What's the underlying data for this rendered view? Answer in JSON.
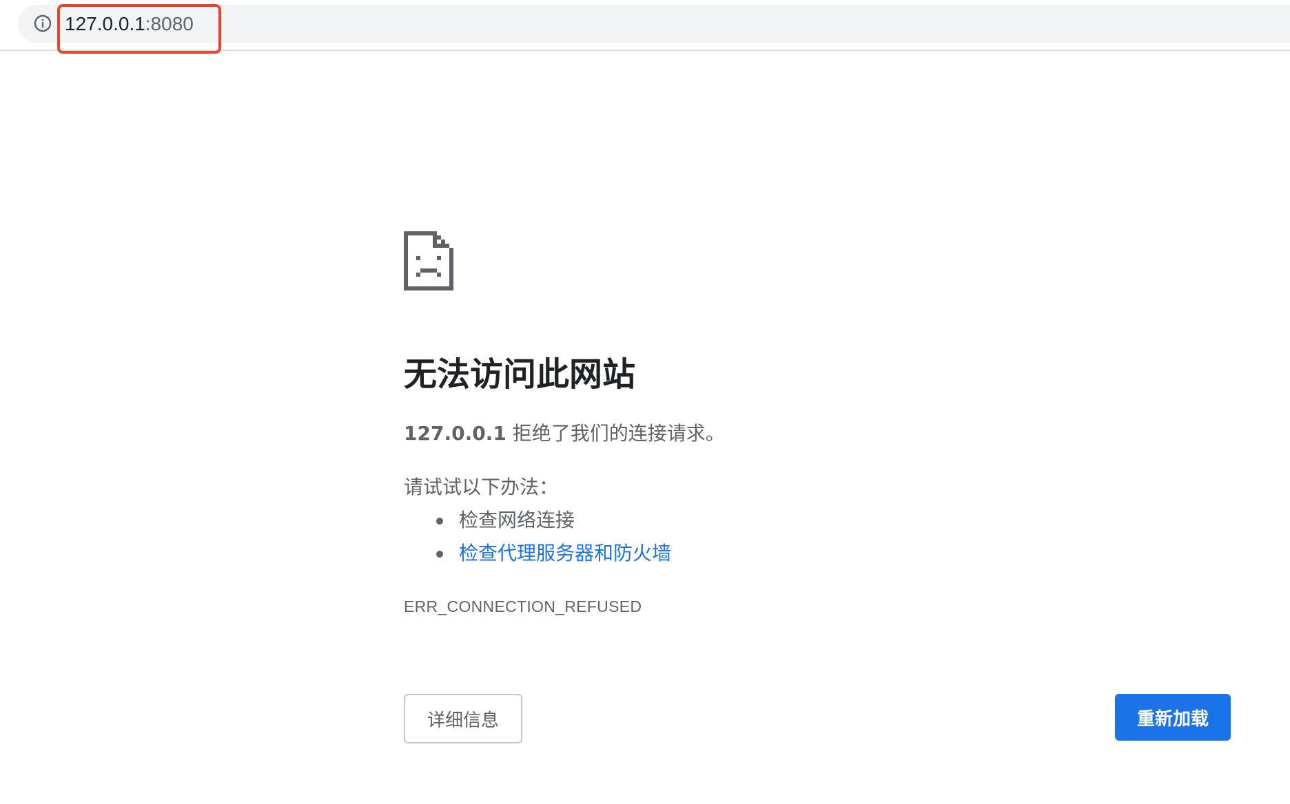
{
  "address_bar": {
    "host": "127.0.0.1",
    "port": ":8080",
    "icon": "info-icon"
  },
  "error_page": {
    "icon": "sad-page-icon",
    "heading": "无法访问此网站",
    "message_host": "127.0.0.1",
    "message_text": " 拒绝了我们的连接请求。",
    "suggestions_title": "请试试以下办法：",
    "suggestions": [
      {
        "label": "检查网络连接",
        "is_link": false
      },
      {
        "label": "检查代理服务器和防火墙",
        "is_link": true
      }
    ],
    "error_code": "ERR_CONNECTION_REFUSED",
    "details_button": "详细信息",
    "reload_button": "重新加载"
  },
  "colors": {
    "link": "#1a73e8",
    "primary_button": "#1a73e8",
    "highlight": "#e8462a",
    "text_secondary": "#5f6368",
    "text_primary": "#202124"
  }
}
